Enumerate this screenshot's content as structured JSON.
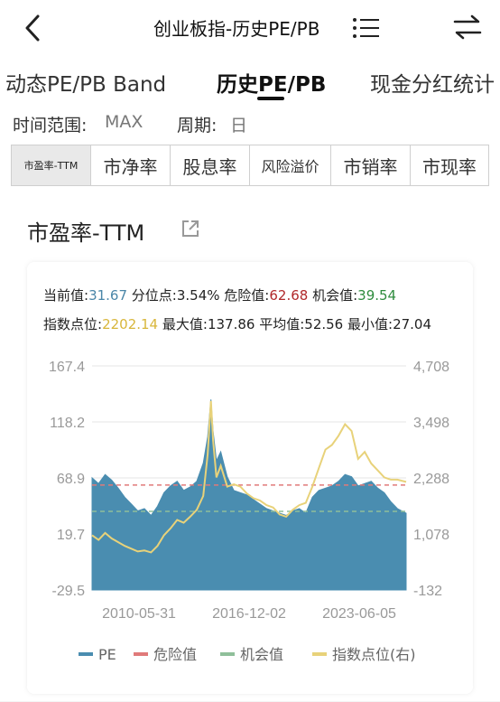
{
  "nav": {
    "title": "创业板指-历史PE/PB"
  },
  "tabs": [
    {
      "label": "动态PE/PB Band"
    },
    {
      "label": "历史PE/PB"
    },
    {
      "label": "现金分红统计"
    }
  ],
  "filters": {
    "range_label": "时间范围:",
    "range_value": "MAX",
    "period_label": "周期:",
    "period_value": "日"
  },
  "subtabs": [
    "市盈率-TTM",
    "市净率",
    "股息率",
    "风险溢价",
    "市销率",
    "市现率"
  ],
  "section": {
    "title": "市盈率-TTM"
  },
  "stats": {
    "current_label": "当前值:",
    "current_value": "31.67",
    "pct_label": "分位点:",
    "pct_value": "3.54%",
    "danger_label": "危险值:",
    "danger_value": "62.68",
    "chance_label": "机会值:",
    "chance_value": "39.54",
    "index_label": "指数点位:",
    "index_value": "2202.14",
    "max_label": "最大值:",
    "max_value": "137.86",
    "avg_label": "平均值:",
    "avg_value": "52.56",
    "min_label": "最小值:",
    "min_value": "27.04"
  },
  "colors": {
    "pe": "#4a8db0",
    "danger": "#e07a7a",
    "chance": "#8fbf9a",
    "index": "#e8d27a",
    "grid": "#e6e6e6"
  },
  "chart_data": {
    "type": "area",
    "title": "",
    "y_left_ticks": [
      "167.4",
      "118.2",
      "68.9",
      "19.7",
      "-29.5"
    ],
    "y_right_ticks": [
      "4,708",
      "3,498",
      "2,288",
      "1,078",
      "-132"
    ],
    "x_ticks": [
      "2010-05-31",
      "2016-12-02",
      "2023-06-05"
    ],
    "ylim_left": [
      -29.5,
      167.4
    ],
    "ylim_right": [
      -132,
      4708
    ],
    "xlim": [
      2010.0,
      2024.4
    ],
    "danger_level": 62.68,
    "chance_level": 39.54,
    "legend": [
      "PE",
      "危险值",
      "机会值",
      "指数点位(右)"
    ],
    "series": [
      {
        "name": "PE",
        "axis": "left",
        "x": [
          2010.0,
          2010.3,
          2010.6,
          2010.9,
          2011.2,
          2011.5,
          2011.8,
          2012.1,
          2012.4,
          2012.7,
          2013.0,
          2013.3,
          2013.6,
          2013.9,
          2014.2,
          2014.5,
          2014.8,
          2015.1,
          2015.3,
          2015.45,
          2015.55,
          2015.7,
          2015.9,
          2016.2,
          2016.5,
          2016.8,
          2017.1,
          2017.4,
          2017.7,
          2018.0,
          2018.3,
          2018.6,
          2018.9,
          2019.2,
          2019.5,
          2019.8,
          2020.1,
          2020.4,
          2020.7,
          2021.0,
          2021.3,
          2021.6,
          2021.9,
          2022.2,
          2022.5,
          2022.8,
          2023.1,
          2023.4,
          2023.7,
          2024.0,
          2024.4
        ],
        "values": [
          69,
          64,
          72,
          67,
          60,
          52,
          46,
          40,
          42,
          36,
          44,
          56,
          62,
          66,
          58,
          61,
          66,
          82,
          105,
          137.9,
          110,
          84,
          92,
          70,
          58,
          56,
          54,
          50,
          46,
          42,
          40,
          38,
          36,
          40,
          42,
          38,
          52,
          58,
          60,
          62,
          66,
          72,
          70,
          62,
          64,
          66,
          60,
          56,
          48,
          42,
          38
        ]
      },
      {
        "name": "指数点位(右)",
        "axis": "right",
        "x": [
          2010.0,
          2010.3,
          2010.6,
          2010.9,
          2011.2,
          2011.5,
          2011.8,
          2012.1,
          2012.4,
          2012.7,
          2013.0,
          2013.3,
          2013.6,
          2013.9,
          2014.2,
          2014.5,
          2014.8,
          2015.1,
          2015.3,
          2015.45,
          2015.55,
          2015.7,
          2015.9,
          2016.2,
          2016.5,
          2016.8,
          2017.1,
          2017.4,
          2017.7,
          2018.0,
          2018.3,
          2018.6,
          2018.9,
          2019.2,
          2019.5,
          2019.8,
          2020.1,
          2020.4,
          2020.7,
          2021.0,
          2021.3,
          2021.6,
          2021.9,
          2022.2,
          2022.5,
          2022.8,
          2023.1,
          2023.4,
          2023.7,
          2024.0,
          2024.4
        ],
        "values": [
          1050,
          950,
          1100,
          980,
          900,
          820,
          760,
          700,
          720,
          680,
          820,
          1050,
          1200,
          1380,
          1320,
          1450,
          1600,
          1900,
          2800,
          3950,
          3100,
          2300,
          2550,
          2100,
          2150,
          2100,
          1950,
          1850,
          1800,
          1700,
          1650,
          1500,
          1450,
          1600,
          1700,
          1750,
          2100,
          2500,
          2900,
          3000,
          3200,
          3450,
          3300,
          2700,
          2850,
          2600,
          2450,
          2300,
          2250,
          2250,
          2202
        ]
      },
      {
        "name": "危险值",
        "axis": "left",
        "constant": 62.68
      },
      {
        "name": "机会值",
        "axis": "left",
        "constant": 39.54
      }
    ]
  }
}
